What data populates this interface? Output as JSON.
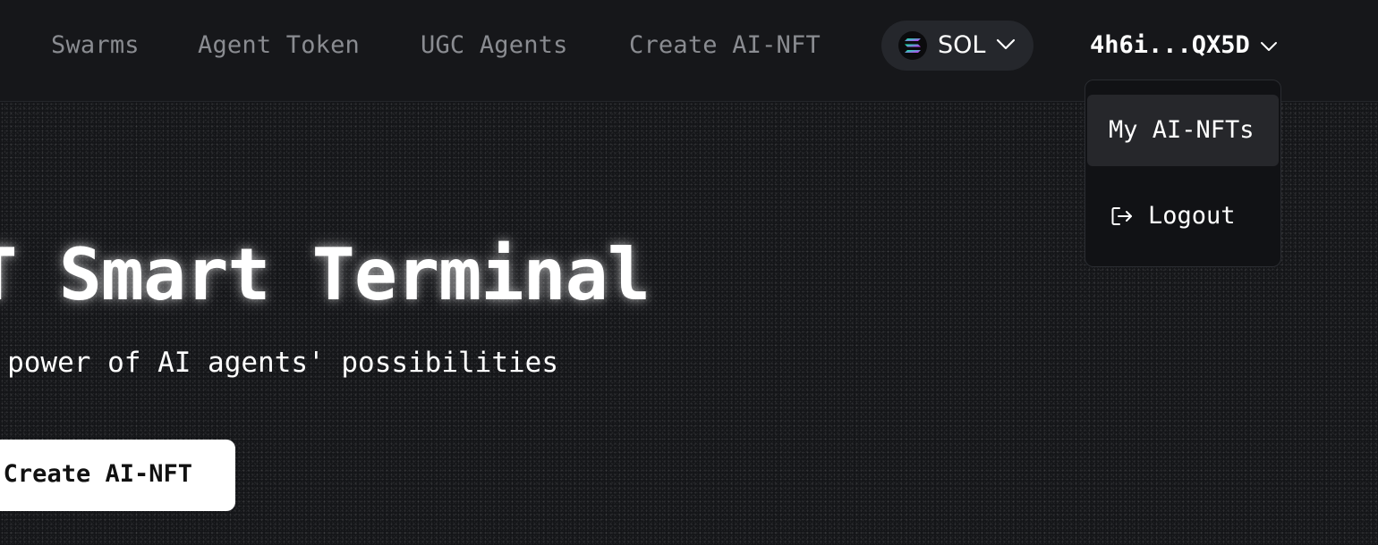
{
  "nav": {
    "links": [
      {
        "label": "Swarms"
      },
      {
        "label": "Agent Token"
      },
      {
        "label": "UGC Agents"
      },
      {
        "label": "Create AI-NFT"
      }
    ],
    "chain_select": {
      "label": "SOL",
      "icon": "solana-logo-icon"
    },
    "wallet": {
      "label": "4h6i...QX5D",
      "icon": "chevron-down-icon"
    }
  },
  "dropdown": {
    "items": [
      {
        "label": "My AI-NFTs",
        "active": true
      },
      {
        "label": "Logout",
        "icon": "logout-icon"
      }
    ]
  },
  "hero": {
    "title": "AI-NFT Smart Terminal",
    "subtitle": "Unlock the power of AI agents' possibilities",
    "cta_label": "Create AI-NFT"
  },
  "colors": {
    "background": "#131417",
    "navbar": "#16171a",
    "nav_link": "#8a8c91",
    "pill": "#25272c",
    "dropdown_active": "#26272b",
    "cta_background": "#ffffff"
  }
}
